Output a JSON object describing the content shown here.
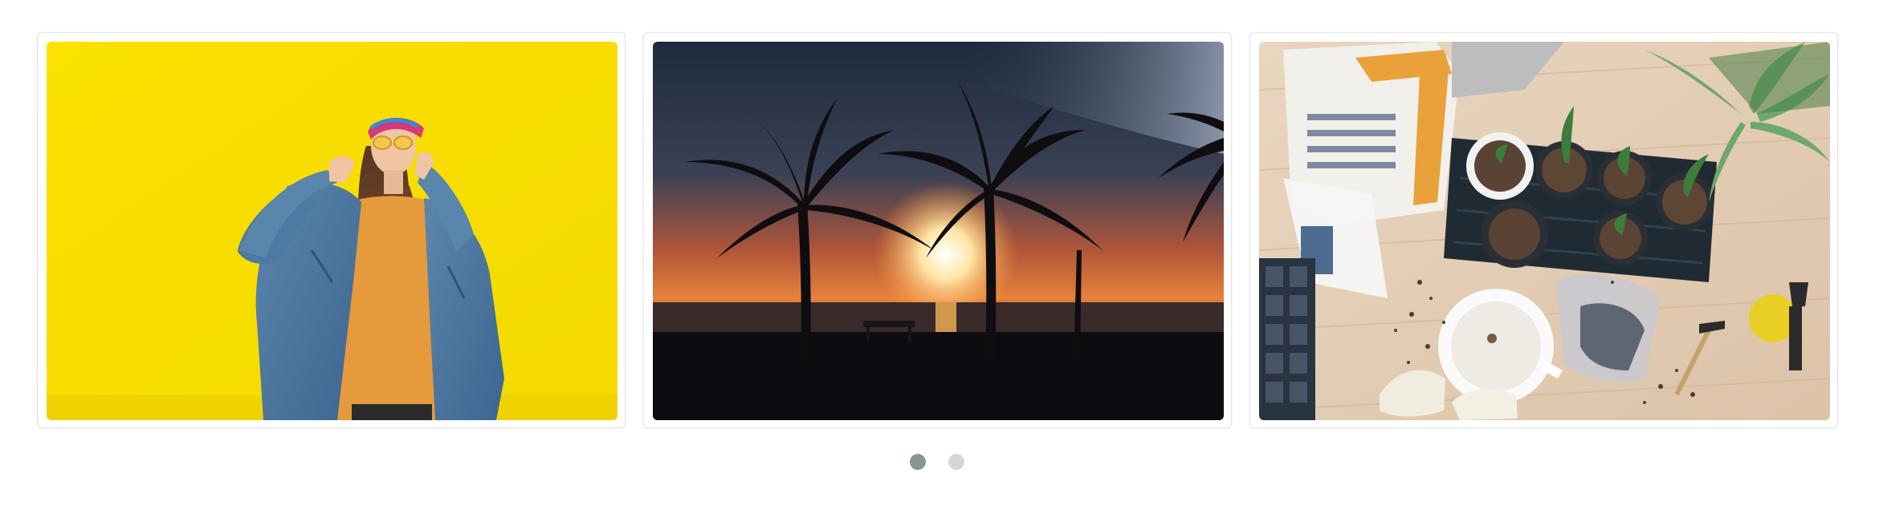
{
  "carousel": {
    "slides": [
      {
        "subject": "woman-yellow-wall-photo"
      },
      {
        "subject": "palm-sunset-beach-photo"
      },
      {
        "subject": "potting-plants-table-photo"
      }
    ],
    "pagination": {
      "pages": 2,
      "active_page": 1,
      "active_color": "#869791",
      "inactive_color": "#d6d6d6"
    }
  }
}
